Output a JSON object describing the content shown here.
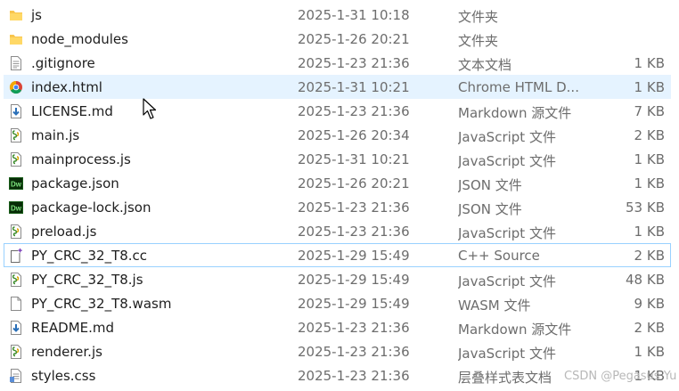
{
  "files": [
    {
      "name": "js",
      "date": "2025-1-31 10:18",
      "type": "文件夹",
      "size": "",
      "icon": "folder-icon"
    },
    {
      "name": "node_modules",
      "date": "2025-1-26 20:21",
      "type": "文件夹",
      "size": "",
      "icon": "folder-icon"
    },
    {
      "name": ".gitignore",
      "date": "2025-1-23 21:36",
      "type": "文本文档",
      "size": "1 KB",
      "icon": "text-file-icon"
    },
    {
      "name": "index.html",
      "date": "2025-1-31 10:21",
      "type": "Chrome HTML D...",
      "size": "1 KB",
      "icon": "chrome-icon"
    },
    {
      "name": "LICENSE.md",
      "date": "2025-1-23 21:36",
      "type": "Markdown 源文件",
      "size": "7 KB",
      "icon": "markdown-icon"
    },
    {
      "name": "main.js",
      "date": "2025-1-26 20:34",
      "type": "JavaScript 文件",
      "size": "2 KB",
      "icon": "javascript-file-icon"
    },
    {
      "name": "mainprocess.js",
      "date": "2025-1-31 10:21",
      "type": "JavaScript 文件",
      "size": "1 KB",
      "icon": "javascript-file-icon"
    },
    {
      "name": "package.json",
      "date": "2025-1-26 20:21",
      "type": "JSON 文件",
      "size": "1 KB",
      "icon": "dreamweaver-icon"
    },
    {
      "name": "package-lock.json",
      "date": "2025-1-23 21:36",
      "type": "JSON 文件",
      "size": "53 KB",
      "icon": "dreamweaver-icon"
    },
    {
      "name": "preload.js",
      "date": "2025-1-23 21:36",
      "type": "JavaScript 文件",
      "size": "1 KB",
      "icon": "javascript-file-icon"
    },
    {
      "name": "PY_CRC_32_T8.cc",
      "date": "2025-1-29 15:49",
      "type": "C++ Source",
      "size": "2 KB",
      "icon": "cpp-file-icon"
    },
    {
      "name": "PY_CRC_32_T8.js",
      "date": "2025-1-29 15:49",
      "type": "JavaScript 文件",
      "size": "48 KB",
      "icon": "javascript-file-icon"
    },
    {
      "name": "PY_CRC_32_T8.wasm",
      "date": "2025-1-29 15:49",
      "type": "WASM 文件",
      "size": "9 KB",
      "icon": "blank-file-icon"
    },
    {
      "name": "README.md",
      "date": "2025-1-23 21:36",
      "type": "Markdown 源文件",
      "size": "2 KB",
      "icon": "markdown-icon"
    },
    {
      "name": "renderer.js",
      "date": "2025-1-23 21:36",
      "type": "JavaScript 文件",
      "size": "1 KB",
      "icon": "javascript-file-icon"
    },
    {
      "name": "styles.css",
      "date": "2025-1-23 21:36",
      "type": "层叠样式表文档",
      "size": "1 KB",
      "icon": "css-file-icon"
    }
  ],
  "hover_index": 3,
  "outlined_index": 10,
  "watermark": "CSDN @Pegasus Yu",
  "colors": {
    "hover": "#e5f3ff",
    "outline": "#99d1ff",
    "folder": "#f8c54d",
    "dw_green": "#1a5e1a"
  }
}
